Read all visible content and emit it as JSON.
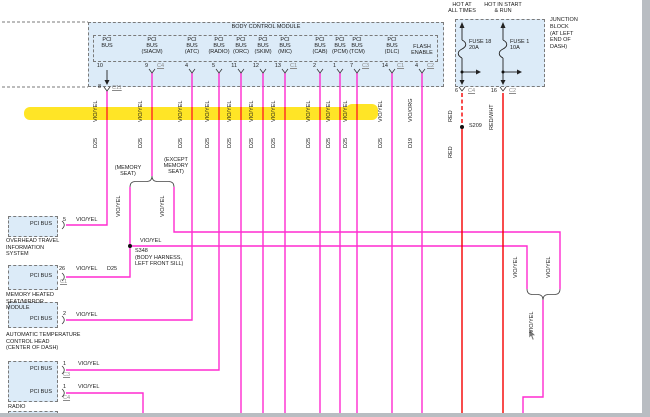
{
  "bcm": {
    "title": "BODY CONTROL MODULE",
    "pins": [
      {
        "bus": "PCI\nBUS",
        "pin": "10",
        "conn": ""
      },
      {
        "bus": "PCI\nBUS\n(SIACM)",
        "pin": "9",
        "conn": "C4"
      },
      {
        "bus": "PCI\nBUS\n(ATC)",
        "pin": "4",
        "conn": ""
      },
      {
        "bus": "PCI\nBUS\n(RADIO)",
        "pin": "5",
        "conn": ""
      },
      {
        "bus": "PCI\nBUS\n(ORC)",
        "pin": "11",
        "conn": ""
      },
      {
        "bus": "PCI\nBUS\n(SKIM)",
        "pin": "12",
        "conn": ""
      },
      {
        "bus": "PCI\nBUS\n(MIC)",
        "pin": "13",
        "conn": "C1"
      },
      {
        "bus": "PCI\nBUS\n(CAB)",
        "pin": "2",
        "conn": ""
      },
      {
        "bus": "PCI\nBUS\n(PCM)",
        "pin": "1",
        "conn": ""
      },
      {
        "bus": "PCI\nBUS\n(TCM)",
        "pin": "7",
        "conn": "C3"
      },
      {
        "bus": "PCI\nBUS\n(DLC)",
        "pin": "14",
        "conn": "C1"
      },
      {
        "bus": "FLASH\nENABLE",
        "pin": "4",
        "conn": "C2"
      }
    ],
    "sub_pin": {
      "pin": "8",
      "conn": "C11"
    },
    "wires": [
      {
        "color": "VIO/YEL",
        "circuit": "D25"
      },
      {
        "color": "VIO/YEL",
        "circuit": "D25"
      },
      {
        "color": "VIO/YEL",
        "circuit": "D25"
      },
      {
        "color": "VIO/YEL",
        "circuit": "D25"
      },
      {
        "color": "VIO/YEL",
        "circuit": "D25"
      },
      {
        "color": "VIO/YEL",
        "circuit": "D25"
      },
      {
        "color": "VIO/YEL",
        "circuit": "D25"
      },
      {
        "color": "VIO/YEL",
        "circuit": "D25"
      },
      {
        "color": "VIO/YEL",
        "circuit": "D25"
      },
      {
        "color": "VIO/YEL",
        "circuit": "D25"
      },
      {
        "color": "VIO/YEL",
        "circuit": "D25"
      },
      {
        "color": "VIO/ORG",
        "circuit": "D19"
      }
    ]
  },
  "junction": {
    "label": "JUNCTION\nBLOCK\n(AT LEFT\nEND OF\nDASH)",
    "hot_left": "HOT AT\nALL TIMES",
    "hot_right": "HOT IN START\n& RUN",
    "fuse_left": {
      "name": "FUSE 18\n20A",
      "pin": "6",
      "conn": "C4"
    },
    "fuse_right": {
      "name": "FUSE 1\n10A",
      "pin": "16",
      "conn": "C2"
    },
    "wire_left_top": "RED",
    "splice": "S209",
    "wire_left_bottom": "RED",
    "wire_right": "RED/WHT"
  },
  "branches": {
    "left_label": "(MEMORY\nSEAT)",
    "right_label": "(EXCEPT\nMEMORY\nSEAT)",
    "left_wire": "VIO/YEL",
    "right_wire": "VIO/YEL",
    "merge_left_wire": "VIO/YEL",
    "merge_right_wire": "VIO/YEL",
    "merged_wire": "VIO/YEL"
  },
  "s348": {
    "label": "S348\n(BODY HARNESS,\nLEFT FRONT SILL)",
    "wire": "VIO/YEL"
  },
  "components": [
    {
      "bus": "PCI BUS",
      "pin": "5",
      "conn": "",
      "wire": "VIO/YEL",
      "circuit": "",
      "name": "OVERHEAD TRAVEL\nINFORMATION\nSYSTEM"
    },
    {
      "bus": "PCI BUS",
      "pin": "26",
      "conn": "C1",
      "wire": "VIO/YEL",
      "circuit": "D25",
      "name": "MEMORY HEATED\nSEAT/MIRROR\nMODULE"
    },
    {
      "bus": "PCI BUS",
      "pin": "2",
      "conn": "",
      "wire": "VIO/YEL",
      "circuit": "",
      "name": "AUTOMATIC TEMPERATURE\nCONTROL HEAD\n(CENTER OF DASH)"
    },
    {
      "bus": "PCI BUS",
      "pin": "1",
      "conn": "C3",
      "wire": "VIO/YEL",
      "bus2": "PCI BUS",
      "pin2": "1",
      "conn2": "C4",
      "wire2": "VIO/YEL",
      "circuit": "",
      "name": "RADIO"
    }
  ],
  "colors": {
    "pci_wire": "#ff2bd0",
    "power_wire": "#f40000",
    "highlight": "#ffe100",
    "module_fill": "#dcebf8"
  }
}
